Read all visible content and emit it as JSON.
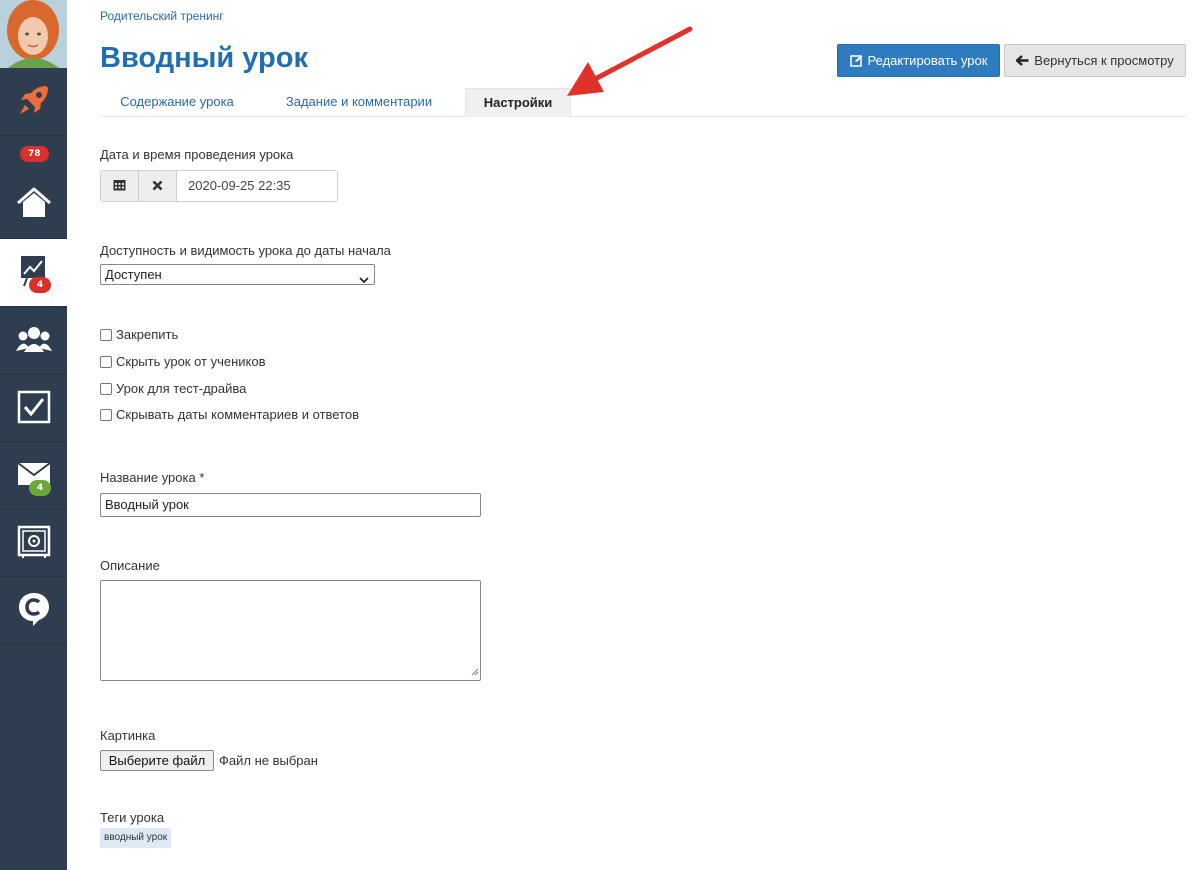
{
  "sidebar": {
    "items": [
      {
        "icon": "rocket-icon",
        "badge": ""
      },
      {
        "icon": "home-icon",
        "badge": "78"
      },
      {
        "icon": "chart-board-icon",
        "badge": "4"
      },
      {
        "icon": "users-group-icon",
        "badge": ""
      },
      {
        "icon": "checkbox-icon",
        "badge": ""
      },
      {
        "icon": "mail-icon",
        "badge": "4"
      },
      {
        "icon": "safe-icon",
        "badge": ""
      },
      {
        "icon": "chat-c-icon",
        "badge": ""
      }
    ],
    "colors": {
      "background": "#2e3e50",
      "rocket": "#ef6c3b",
      "badge_red": "#d9302b",
      "badge_green": "#6aa83a"
    }
  },
  "header": {
    "breadcrumb": "Родительский тренинг",
    "title": "Вводный урок",
    "edit_button": "Редактировать урок",
    "back_button": "Вернуться к просмотру"
  },
  "tabs": [
    {
      "label": "Содержание урока",
      "active": false
    },
    {
      "label": "Задание и комментарии",
      "active": false
    },
    {
      "label": "Настройки",
      "active": true
    }
  ],
  "form": {
    "date_label": "Дата и время проведения урока",
    "date_value": "2020-09-25 22:35",
    "visibility_label": "Доступность и видимость урока до даты начала",
    "visibility_value": "Доступен",
    "checkboxes": [
      {
        "label": "Закрепить",
        "checked": false
      },
      {
        "label": "Скрыть урок от учеников",
        "checked": false
      },
      {
        "label": "Урок для тест-драйва",
        "checked": false
      },
      {
        "label": "Скрывать даты комментариев и ответов",
        "checked": false
      }
    ],
    "name_label": "Название урока *",
    "name_value": "Вводный урок",
    "description_label": "Описание",
    "description_value": "",
    "image_label": "Картинка",
    "file_button": "Выберите файл",
    "file_status": "Файл не выбран",
    "tags_label": "Теги урока",
    "tags": [
      "вводный урок"
    ]
  },
  "annotation": {
    "color": "#e0322a"
  },
  "accent": "#2f7bbf"
}
